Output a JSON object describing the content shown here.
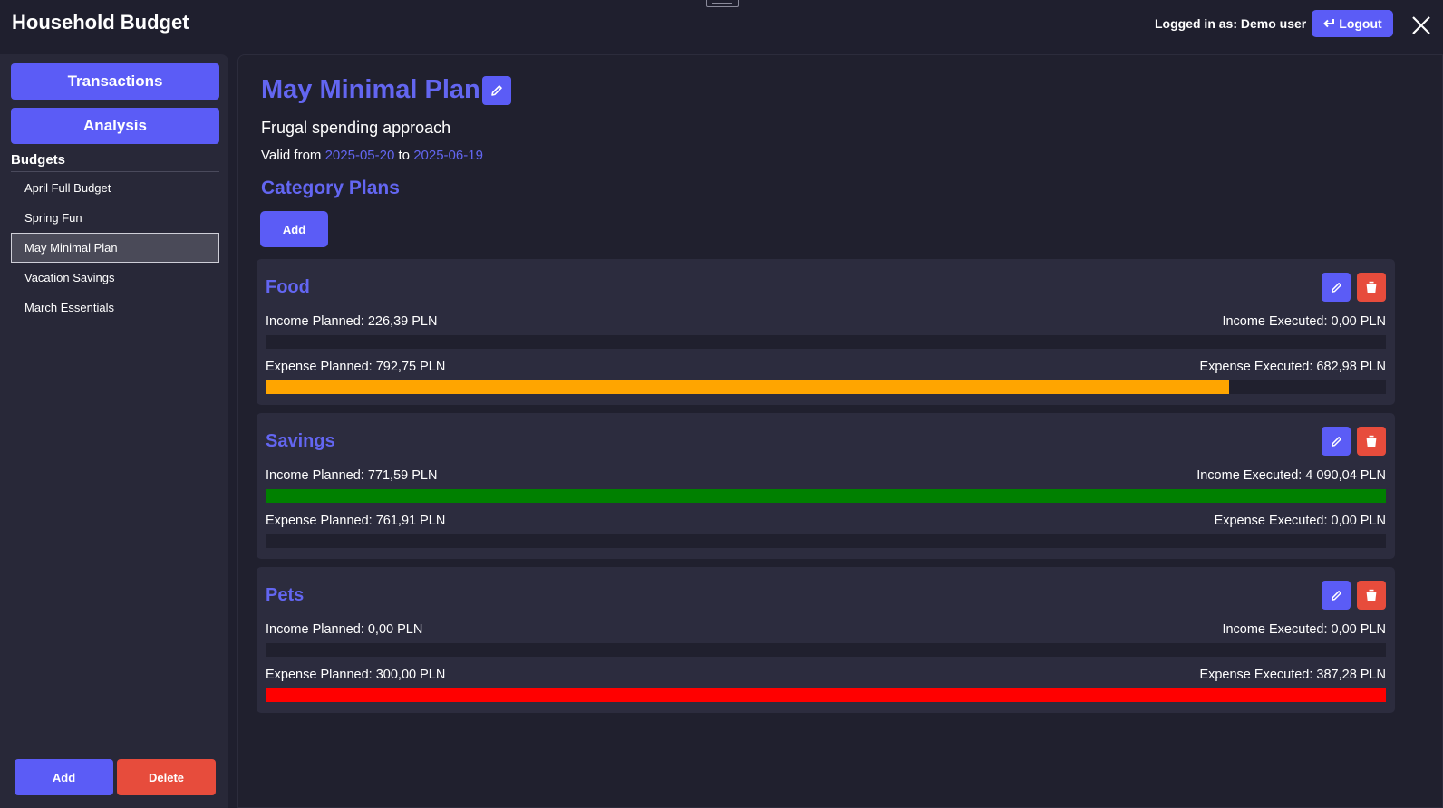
{
  "header": {
    "app_title": "Household Budget",
    "login_text": "Logged in as: Demo user",
    "logout_label": "Logout"
  },
  "sidebar": {
    "transactions_label": "Transactions",
    "analysis_label": "Analysis",
    "budgets_heading": "Budgets",
    "budgets": [
      {
        "label": "April Full Budget",
        "selected": false
      },
      {
        "label": "Spring Fun",
        "selected": false
      },
      {
        "label": "May Minimal Plan",
        "selected": true
      },
      {
        "label": "Vacation Savings",
        "selected": false
      },
      {
        "label": "March Essentials",
        "selected": false
      }
    ],
    "add_label": "Add",
    "delete_label": "Delete"
  },
  "plan": {
    "title": "May Minimal Plan",
    "description": "Frugal spending approach",
    "valid_from_prefix": "Valid from",
    "valid_from": "2025-05-20",
    "valid_to_prefix": "to",
    "valid_to": "2025-06-19",
    "category_plans_title": "Category Plans",
    "add_label": "Add"
  },
  "categories": [
    {
      "name": "Food",
      "income_planned": "Income Planned: 226,39 PLN",
      "income_executed": "Income Executed: 0,00 PLN",
      "income_progress": 0,
      "income_color": "#008000",
      "expense_planned": "Expense Planned: 792,75 PLN",
      "expense_executed": "Expense Executed: 682,98 PLN",
      "expense_progress": 0.86,
      "expense_color": "#ffa500"
    },
    {
      "name": "Savings",
      "income_planned": "Income Planned: 771,59 PLN",
      "income_executed": "Income Executed: 4 090,04 PLN",
      "income_progress": 1,
      "income_color": "#008000",
      "expense_planned": "Expense Planned: 761,91 PLN",
      "expense_executed": "Expense Executed: 0,00 PLN",
      "expense_progress": 0,
      "expense_color": "#ffa500"
    },
    {
      "name": "Pets",
      "income_planned": "Income Planned: 0,00 PLN",
      "income_executed": "Income Executed: 0,00 PLN",
      "income_progress": 0,
      "income_color": "#008000",
      "expense_planned": "Expense Planned: 300,00 PLN",
      "expense_executed": "Expense Executed: 387,28 PLN",
      "expense_progress": 1,
      "expense_color": "#ff0000"
    }
  ],
  "colors": {
    "accent": "#5b5cf6",
    "accent_text": "#6366f1",
    "danger": "#e74c3c"
  },
  "icons": {
    "logout": "logout-arrow-icon",
    "close": "close-icon",
    "edit": "pencil-icon",
    "delete": "trash-icon"
  }
}
